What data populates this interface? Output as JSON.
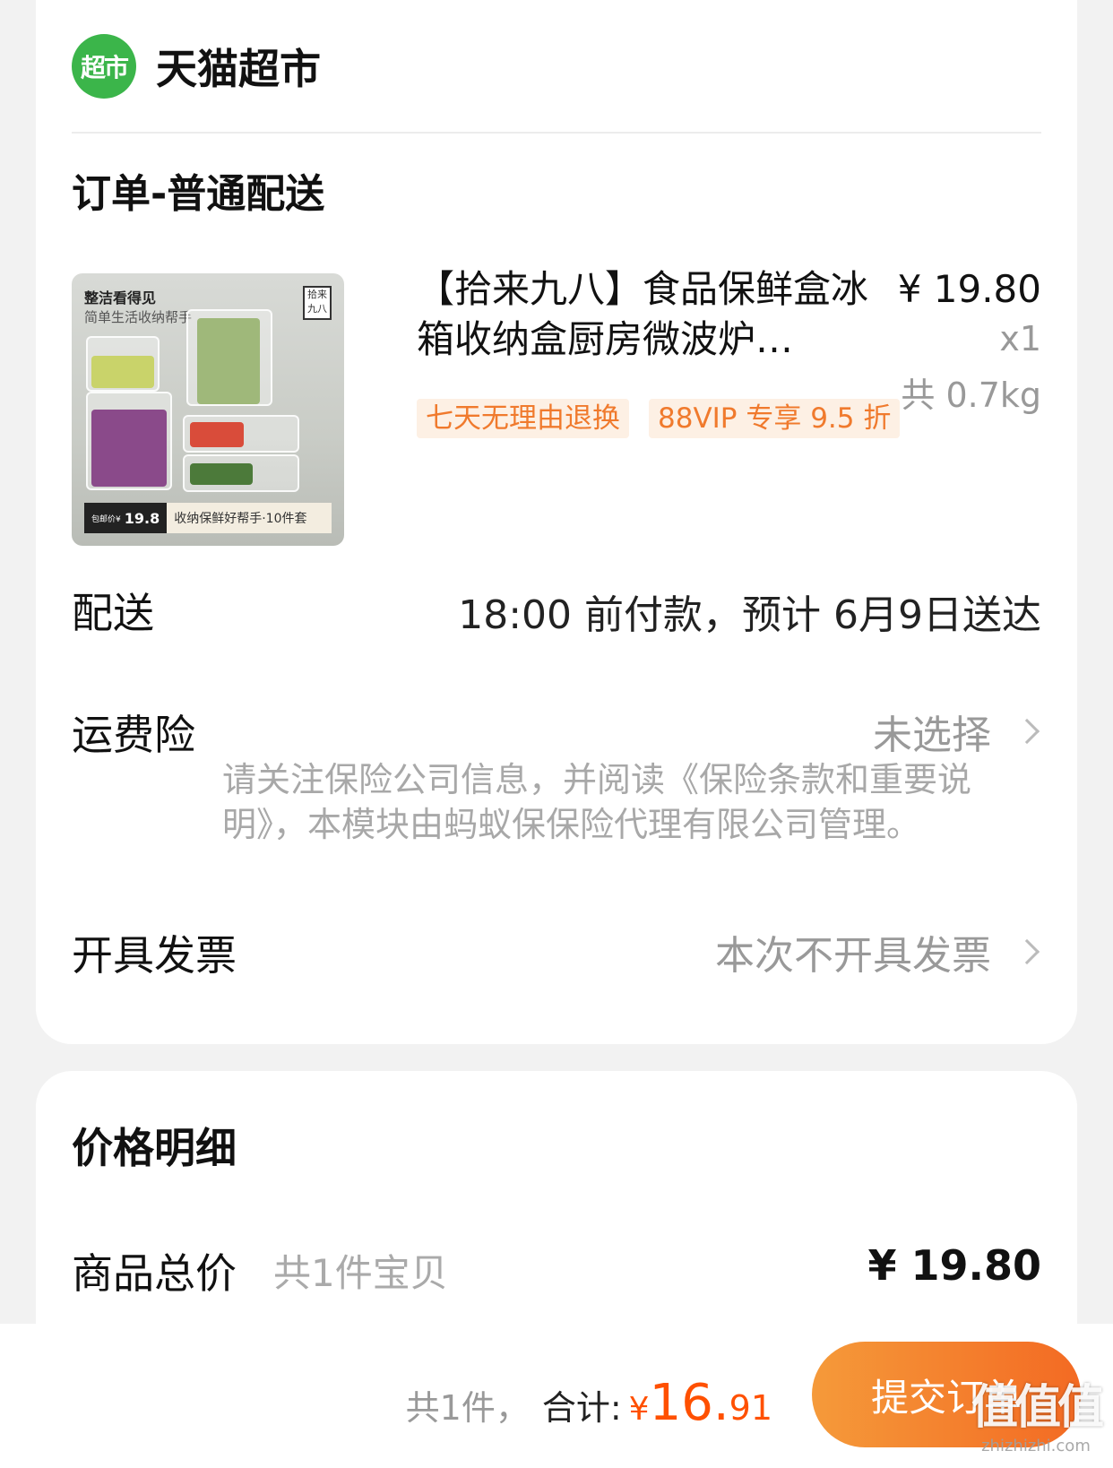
{
  "store": {
    "logo_text": "超市",
    "name": "天猫超市"
  },
  "order": {
    "section_title": "订单-普通配送",
    "product": {
      "title": "【拾来九八】食品保鲜盒冰箱收纳盒厨房微波炉…",
      "price": "¥ 19.80",
      "quantity": "x1",
      "weight": "共 0.7kg",
      "tags": [
        "七天无理由退换",
        "88VIP 专享 9.5 折"
      ],
      "image": {
        "line1": "整洁看得见",
        "line2": "简单生活收纳帮手",
        "brand": "拾来九八",
        "banner_price_label": "包邮价¥",
        "banner_price": "19.8",
        "banner_desc": "收纳保鲜好帮手·10件套"
      }
    },
    "delivery": {
      "label": "配送",
      "value": "18:00 前付款，预计 6月9日送达"
    },
    "insurance": {
      "label": "运费险",
      "value": "未选择",
      "note": "请关注保险公司信息，并阅读《保险条款和重要说明》，本模块由蚂蚁保保险代理有限公司管理。"
    },
    "invoice": {
      "label": "开具发票",
      "value": "本次不开具发票"
    }
  },
  "price_detail": {
    "title": "价格明细",
    "goods_total_label": "商品总价",
    "goods_total_sub": "共1件宝贝",
    "goods_total_value": "¥ 19.80"
  },
  "bottom_bar": {
    "count": "共1件，",
    "total_label": "合计:",
    "currency": "¥",
    "total_int": "16.",
    "total_dec": "91",
    "submit_label": "提交订单"
  },
  "watermark": {
    "main": "值值值",
    "sub": "zhizhizhi.com"
  },
  "colors": {
    "accent": "#ff5000",
    "store_green": "#3bb54a",
    "tag_text": "#f07a2d",
    "tag_bg": "#fdf0e4"
  }
}
